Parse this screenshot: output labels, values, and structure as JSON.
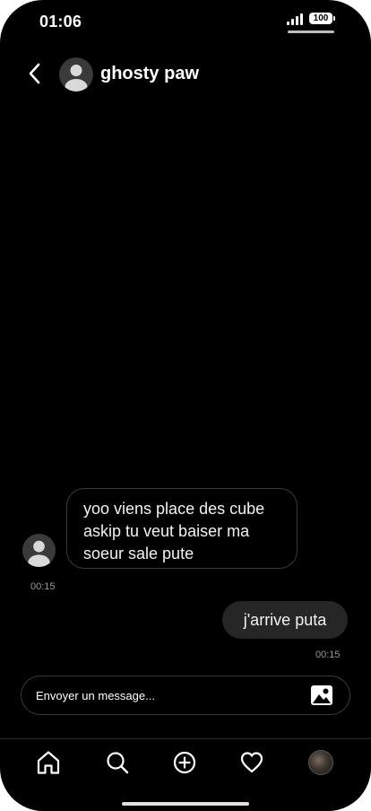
{
  "status_bar": {
    "time": "01:06",
    "battery": "100"
  },
  "header": {
    "contact_name": "ghosty paw"
  },
  "messages": {
    "incoming": {
      "lines": [
        "yoo viens place des cube",
        "askip tu veut baiser ma",
        "soeur sale pute"
      ],
      "time": "00:15"
    },
    "outgoing": {
      "text": "j'arrive puta",
      "time": "00:15"
    }
  },
  "composer": {
    "placeholder": "Envoyer un message..."
  },
  "nav": {
    "items": [
      "home-icon",
      "search-icon",
      "add-icon",
      "heart-icon",
      "profile-avatar"
    ]
  },
  "colors": {
    "background": "#000000",
    "outgoing_bubble": "#262626",
    "border": "#3a3a3a",
    "timestamp": "#9a9a9a"
  }
}
